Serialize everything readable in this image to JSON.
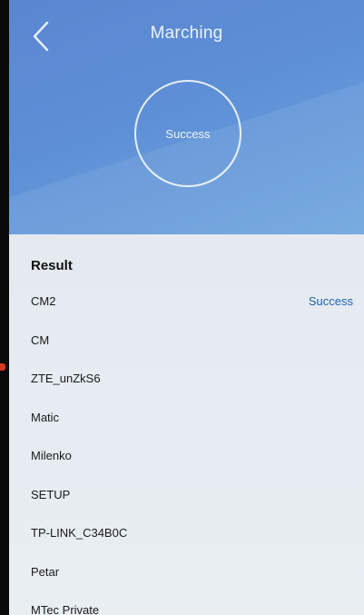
{
  "header": {
    "title": "Marching",
    "back_icon": "chevron-left-icon",
    "status": "Success",
    "background_color": "#5d8fd6"
  },
  "result": {
    "title": "Result",
    "items": [
      {
        "name": "CM2",
        "status": "Success"
      },
      {
        "name": "CM",
        "status": ""
      },
      {
        "name": "ZTE_unZkS6",
        "status": ""
      },
      {
        "name": "Matic",
        "status": ""
      },
      {
        "name": "Milenko",
        "status": ""
      },
      {
        "name": "SETUP",
        "status": ""
      },
      {
        "name": "TP-LINK_C34B0C",
        "status": ""
      },
      {
        "name": "Petar",
        "status": ""
      },
      {
        "name": "MTec Private",
        "status": ""
      }
    ],
    "status_color": "#1e63b8"
  }
}
